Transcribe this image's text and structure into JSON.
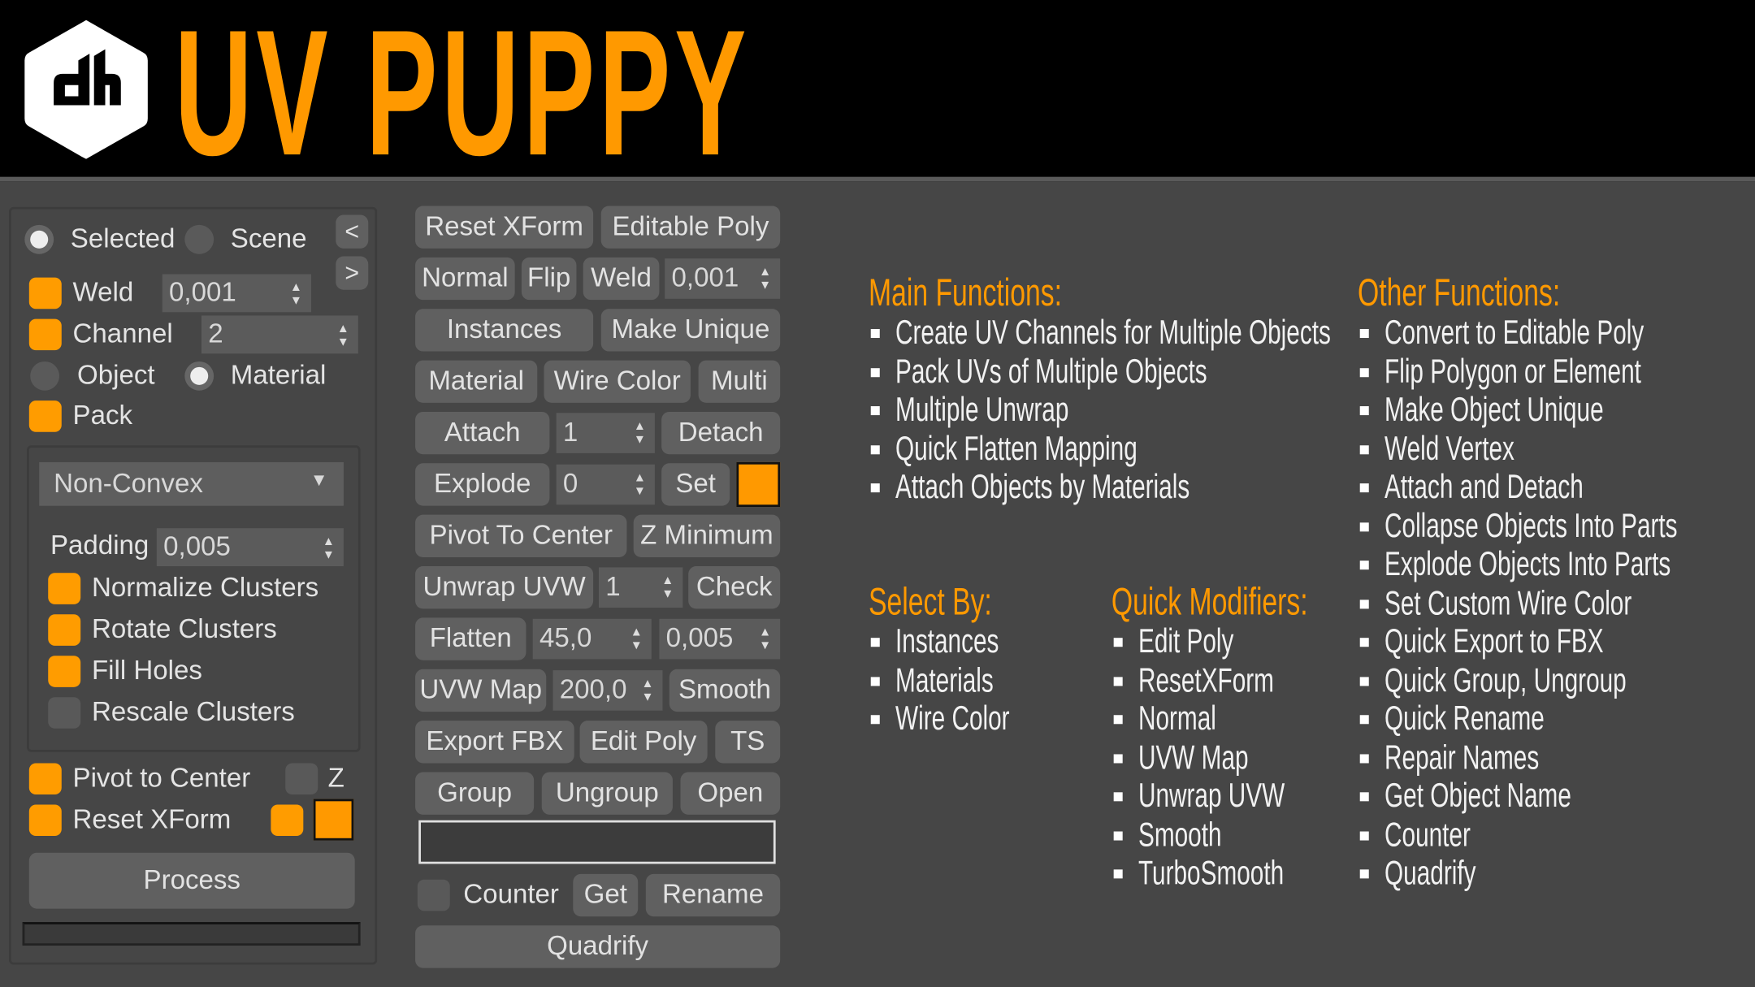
{
  "app": {
    "title": "UV PUPPY",
    "logo_text": "dh",
    "accent": "#ff9900"
  },
  "left": {
    "selected": "Selected",
    "scene": "Scene",
    "prev": "<",
    "next": ">",
    "weld": "Weld",
    "weld_value": "0,001",
    "channel": "Channel",
    "channel_value": "2",
    "object": "Object",
    "material": "Material",
    "pack": "Pack",
    "pack_mode": "Non-Convex",
    "padding": "Padding",
    "padding_value": "0,005",
    "normalize": "Normalize Clusters",
    "rotate": "Rotate Clusters",
    "fill": "Fill Holes",
    "rescale": "Rescale Clusters",
    "pivot": "Pivot to Center",
    "z": "Z",
    "reset": "Reset XForm",
    "process": "Process",
    "progress": 0
  },
  "mid": {
    "reset_xform": "Reset XForm",
    "editable_poly": "Editable Poly",
    "normal": "Normal",
    "flip": "Flip",
    "weld": "Weld",
    "weld_value": "0,001",
    "instances": "Instances",
    "make_unique": "Make Unique",
    "material": "Material",
    "wire_color": "Wire Color",
    "multi": "Multi",
    "attach": "Attach",
    "attach_value": "1",
    "detach": "Detach",
    "explode": "Explode",
    "explode_value": "0",
    "set": "Set",
    "pivot_center": "Pivot To Center",
    "z_minimum": "Z Minimum",
    "unwrap": "Unwrap UVW",
    "unwrap_value": "1",
    "check": "Check",
    "flatten": "Flatten",
    "flatten_angle": "45,0",
    "flatten_spacing": "0,005",
    "uvw_map": "UVW Map",
    "uvw_value": "200,0",
    "smooth": "Smooth",
    "export_fbx": "Export FBX",
    "edit_poly": "Edit Poly",
    "ts": "TS",
    "group": "Group",
    "ungroup": "Ungroup",
    "open": "Open",
    "name_value": "",
    "counter": "Counter",
    "get": "Get",
    "rename": "Rename",
    "quadrify": "Quadrify"
  },
  "info": {
    "main_title": "Main Functions:",
    "main": [
      "Create UV Channels for Multiple Objects",
      "Pack UVs of Multiple Objects",
      "Multiple Unwrap",
      "Quick Flatten Mapping",
      "Attach Objects by Materials"
    ],
    "select_title": "Select By:",
    "select": [
      "Instances",
      "Materials",
      "Wire Color"
    ],
    "quick_title": "Quick Modifiers:",
    "quick": [
      "Edit Poly",
      "ResetXForm",
      "Normal",
      "UVW Map",
      "Unwrap UVW",
      "Smooth",
      "TurboSmooth"
    ],
    "other_title": "Other Functions:",
    "other": [
      "Convert to Editable Poly",
      "Flip Polygon or Element",
      "Make Object Unique",
      "Weld Vertex",
      "Attach and Detach",
      "Collapse Objects Into Parts",
      "Explode Objects Into Parts",
      "Set Custom Wire Color",
      "Quick Export to FBX",
      "Quick Group, Ungroup",
      "Quick Rename",
      "Repair Names",
      "Get Object Name",
      "Counter",
      "Quadrify"
    ]
  }
}
